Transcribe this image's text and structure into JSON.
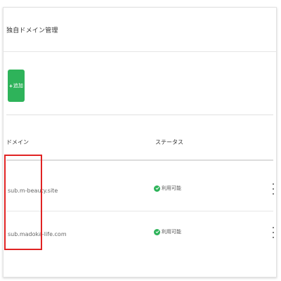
{
  "card": {
    "title": "独自ドメイン管理"
  },
  "toolbar": {
    "add_icon": "+",
    "add_label": "追加"
  },
  "table": {
    "columns": {
      "domain": "ドメイン",
      "status": "ステータス"
    },
    "rows": [
      {
        "domain": "sub.m-beauty.site",
        "status": "利用可能",
        "status_icon": "check-circle-icon"
      },
      {
        "domain": "sub.madoka-life.com",
        "status": "利用可能",
        "status_icon": "check-circle-icon"
      }
    ]
  },
  "colors": {
    "accent_green": "#2eb35a",
    "highlight_red": "#e02323"
  }
}
